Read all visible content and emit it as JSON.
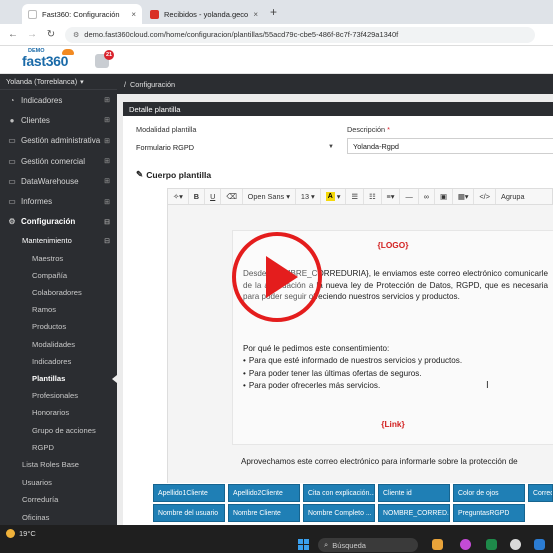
{
  "browser": {
    "tabs": [
      {
        "title": "Fast360: Configuración",
        "close": "×",
        "favicon_color": "#ffffff"
      },
      {
        "title": "Recibidos - yolanda.gecose@g",
        "close": "×",
        "favicon_color": "#d93025"
      }
    ],
    "new_tab": "+",
    "url": "demo.fast360cloud.com/home/configuracion/plantillas/55acd79c-cbe5-486f-8c7f-73f429a1340f"
  },
  "app": {
    "logo_demo": "DEMO",
    "logo_brand": "fast360",
    "notification_count": "21"
  },
  "sidebar": {
    "user": "Yolanda (Torreblanca)",
    "items": [
      {
        "label": "Indicadores",
        "icon": "speedometer-icon",
        "glyph": "◔"
      },
      {
        "label": "Clientes",
        "icon": "users-icon",
        "glyph": "👥"
      },
      {
        "label": "Gestión administrativa",
        "icon": "monitor-icon",
        "glyph": "▭"
      },
      {
        "label": "Gestión comercial",
        "icon": "monitor-icon",
        "glyph": "▭"
      },
      {
        "label": "DataWarehouse",
        "icon": "database-icon",
        "glyph": "▭"
      },
      {
        "label": "Informes",
        "icon": "document-icon",
        "glyph": "▭"
      },
      {
        "label": "Configuración",
        "icon": "gear-icon",
        "glyph": "⚙"
      }
    ],
    "submenu_head": "Mantenimiento",
    "submenu_items": [
      "Maestros",
      "Compañía",
      "Colaboradores",
      "Ramos",
      "Productos",
      "Modalidades",
      "Indicadores",
      "Plantillas",
      "Profesionales",
      "Honorarios",
      "Grupo de acciones",
      "RGPD"
    ],
    "after_items": [
      "Lista Roles Base",
      "Usuarios",
      "Correduría",
      "Oficinas"
    ]
  },
  "breadcrumb": {
    "separator": "/",
    "current": "Configuración"
  },
  "panel": {
    "title": "Detalle plantilla",
    "modalidad_label": "Modalidad plantilla",
    "modalidad_value": "Formulario RGPD",
    "descripcion_label": "Descripción",
    "required_mark": "*",
    "descripcion_value": "Yolanda-Rgpd",
    "section_title": "Cuerpo plantilla"
  },
  "toolbar": {
    "font": "Open Sans",
    "size": "13",
    "highlight": "A",
    "more": "Agrupa"
  },
  "email": {
    "logo_placeholder": "{LOGO}",
    "paragraph1": "Desde {NOMBRE_CORREDURIA}, le enviamos este correo electrónico comunicarle de la adecuación a la nueva ley de Protección de Datos, RGPD, que es necesaria para poder seguir ofreciendo nuestros servicios y productos.",
    "paragraph2": "Por qué le pedimos este consentimiento:",
    "bullets": [
      "Para que esté informado de nuestros servicios y productos.",
      "Para poder tener las últimas ofertas de seguros.",
      "Para poder ofrecerles más servicios."
    ],
    "link_placeholder": "{Link}",
    "paragraph3": "Aprovechamos este correo electrónico para informarle sobre la protección de"
  },
  "chips": {
    "row1": [
      "Apellido1Cliente",
      "Apellido2Cliente",
      "Cita con explicación...",
      "Cliente id",
      "Color de ojos",
      "Corredu"
    ],
    "row2": [
      "Nombre del usuario",
      "Nombre Cliente",
      "Nombre Completo ...",
      "NOMBRE_CORRED...",
      "PreguntasRGPD"
    ]
  },
  "taskbar": {
    "temperature": "19°C",
    "search_placeholder": "Búsqueda"
  }
}
